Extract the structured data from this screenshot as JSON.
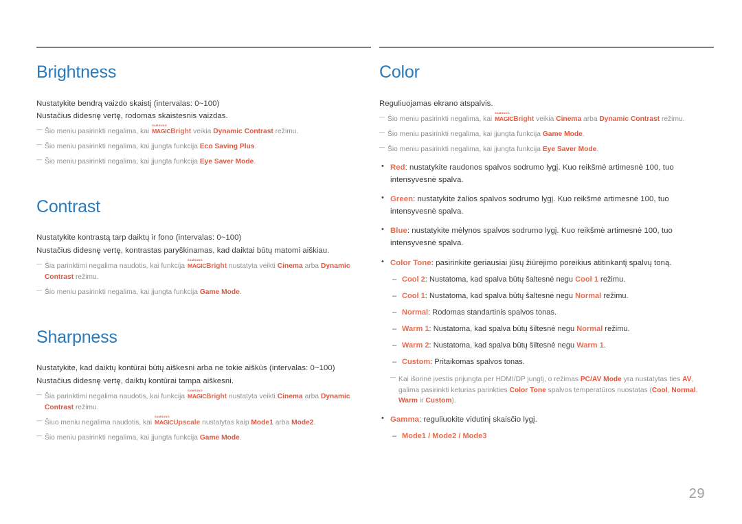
{
  "page": {
    "number": "29",
    "accent_heading": "#2a7ab9",
    "accent_highlight": "#e8553a",
    "rule_color": "#808285",
    "body_color": "#3a3a3a",
    "note_color": "#8d8f92"
  },
  "left_column": {
    "sections": [
      {
        "title": "Brightness",
        "paragraphs": [
          "Nustatykite bendrą vaizdo skaistį (intervalas: 0~100)",
          "Nustačius didesnę vertę, rodomas skaistesnis vaizdas."
        ],
        "notes": [
          {
            "pre": "Šio meniu pasirinkti negalima, kai ",
            "logo": {
              "samsung": "SAMSUNG",
              "magic": "MAGIC",
              "suffix": "Bright"
            },
            "mid": " veikia ",
            "hl1": "Dynamic Contrast",
            "post": " režimu."
          },
          {
            "pre": "Šio meniu pasirinkti negalima, kai įjungta funkcija ",
            "hl1": "Eco Saving Plus",
            "post": "."
          },
          {
            "pre": "Šio meniu pasirinkti negalima, kai įjungta funkcija ",
            "hl1": "Eye Saver Mode",
            "post": "."
          }
        ]
      },
      {
        "title": "Contrast",
        "paragraphs": [
          "Nustatykite kontrastą tarp daiktų ir fono (intervalas: 0~100)",
          "Nustačius didesnę vertę, kontrastas paryškinamas, kad daiktai būtų matomi aiškiau."
        ],
        "notes": [
          {
            "pre": "Šia parinktimi negalima naudotis, kai funkcija ",
            "logo": {
              "samsung": "SAMSUNG",
              "magic": "MAGIC",
              "suffix": "Bright"
            },
            "mid": " nustatyta veikti ",
            "hl1": "Cinema",
            "mid2": " arba ",
            "hl2": "Dynamic Contrast",
            "post": " režimu."
          },
          {
            "pre": "Šio meniu pasirinkti negalima, kai įjungta funkcija ",
            "hl1": "Game Mode",
            "post": "."
          }
        ]
      },
      {
        "title": "Sharpness",
        "paragraphs": [
          "Nustatykite, kad daiktų kontūrai būtų aiškesni arba ne tokie aiškūs (intervalas: 0~100)",
          "Nustačius didesnę vertę, daiktų kontūrai tampa aiškesni."
        ],
        "notes": [
          {
            "pre": "Šia parinktimi negalima naudotis, kai funkcija ",
            "logo": {
              "samsung": "SAMSUNG",
              "magic": "MAGIC",
              "suffix": "Bright"
            },
            "mid": " nustatyta veikti ",
            "hl1": "Cinema",
            "mid2": " arba ",
            "hl2": "Dynamic Contrast",
            "post": " režimu."
          },
          {
            "pre": "Šiuo meniu negalima naudotis, kai ",
            "logo": {
              "samsung": "SAMSUNG",
              "magic": "MAGIC",
              "suffix": "Upscale"
            },
            "mid": " nustatytas kaip ",
            "hl1": "Mode1",
            "mid2": " arba ",
            "hl2": "Mode2",
            "post": "."
          },
          {
            "pre": "Šio meniu pasirinkti negalima, kai įjungta funkcija ",
            "hl1": "Game Mode",
            "post": "."
          }
        ]
      }
    ]
  },
  "right_column": {
    "section": {
      "title": "Color",
      "paragraph": "Reguliuojamas ekrano atspalvis.",
      "notes": [
        {
          "pre": "Šio meniu pasirinkti negalima, kai ",
          "logo": {
            "samsung": "SAMSUNG",
            "magic": "MAGIC",
            "suffix": "Bright"
          },
          "mid": " veikia ",
          "hl1": "Cinema",
          "mid2": " arba ",
          "hl2": "Dynamic Contrast",
          "post": " režimu."
        },
        {
          "pre": "Šio meniu pasirinkti negalima, kai įjungta funkcija ",
          "hl1": "Game Mode",
          "post": "."
        },
        {
          "pre": "Šio meniu pasirinkti negalima, kai įjungta funkcija ",
          "hl1": "Eye Saver Mode",
          "post": "."
        }
      ],
      "bullets": [
        {
          "term": "Red",
          "text": ": nustatykite raudonos spalvos sodrumo lygį. Kuo reikšmė artimesnė 100, tuo intensyvesnė spalva."
        },
        {
          "term": "Green",
          "text": ": nustatykite žalios spalvos sodrumo lygį. Kuo reikšmė artimesnė 100, tuo intensyvesnė spalva."
        },
        {
          "term": "Blue",
          "text": ": nustatykite mėlynos spalvos sodrumo lygį. Kuo reikšmė artimesnė 100, tuo intensyvesnė spalva."
        }
      ],
      "color_tone": {
        "term": "Color Tone",
        "text": ": pasirinkite geriausiai jūsų žiūrėjimo poreikius atitinkantį spalvų toną.",
        "items": [
          {
            "term": "Cool 2",
            "mid": ": Nustatoma, kad spalva būtų šaltesnė negu ",
            "hl": "Cool 1",
            "post": " režimu."
          },
          {
            "term": "Cool 1",
            "mid": ": Nustatoma, kad spalva būtų šaltesnė negu ",
            "hl": "Normal",
            "post": " režimu."
          },
          {
            "term": "Normal",
            "mid": ": Rodomas standartinis spalvos tonas.",
            "hl": "",
            "post": ""
          },
          {
            "term": "Warm 1",
            "mid": ": Nustatoma, kad spalva būtų šiltesnė negu ",
            "hl": "Normal",
            "post": " režimu."
          },
          {
            "term": "Warm 2",
            "mid": ": Nustatoma, kad spalva būtų šiltesnė negu ",
            "hl": "Warm 1",
            "post": "."
          },
          {
            "term": "Custom",
            "mid": ": Pritaikomas spalvos tonas.",
            "hl": "",
            "post": ""
          }
        ],
        "note": {
          "p1": "Kai išorinė įvestis prijungta per HDMI/DP jungtį, o režimas ",
          "h1": "PC/AV Mode",
          "p2": " yra nustatytas ties ",
          "h2": "AV",
          "p3": ", galima pasirinkti keturias parinkties ",
          "h3": "Color Tone",
          "p4": " spalvos temperatūros nuostatas (",
          "h4": "Cool",
          "p5": ", ",
          "h5": "Normal",
          "p6": ", ",
          "h6": "Warm",
          "p7": " ir ",
          "h7": "Custom",
          "p8": ")."
        }
      },
      "gamma": {
        "term": "Gamma",
        "text": ": reguliuokite vidutinį skaisčio lygį.",
        "modes": "Mode1 / Mode2 / Mode3"
      }
    }
  }
}
